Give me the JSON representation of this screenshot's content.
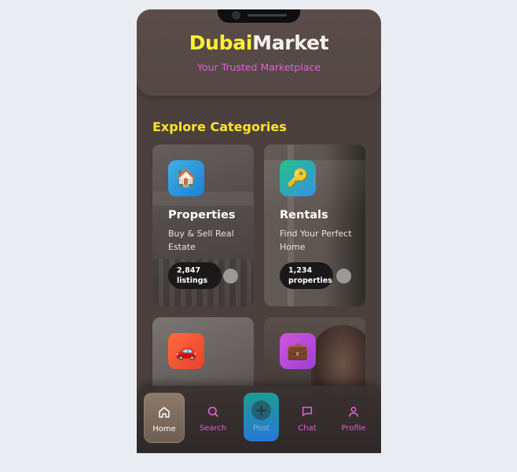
{
  "header": {
    "brand_part1": "Dubai",
    "brand_part2": "Market",
    "tagline": "Your Trusted Marketplace"
  },
  "section_title": "Explore Categories",
  "categories": [
    {
      "icon": "house-icon",
      "name": "Properties",
      "description": "Buy & Sell Real Estate",
      "count_number": "2,847",
      "count_unit": "listings"
    },
    {
      "icon": "key-icon",
      "name": "Rentals",
      "description": "Find Your Perfect Home",
      "count_number": "1,234",
      "count_unit": "properties"
    },
    {
      "icon": "car-icon",
      "name": "",
      "description": "",
      "count_number": "",
      "count_unit": ""
    },
    {
      "icon": "briefcase-icon",
      "name": "",
      "description": "",
      "count_number": "",
      "count_unit": ""
    }
  ],
  "nav": {
    "home": "Home",
    "search": "Search",
    "post": "Post",
    "post_symbol": "+",
    "chat": "Chat",
    "profile": "Profile"
  },
  "colors": {
    "brand_yellow": "#fff12e",
    "accent_pink": "#e060d8",
    "section_yellow": "#ffe52a",
    "background": "#4b403d"
  }
}
